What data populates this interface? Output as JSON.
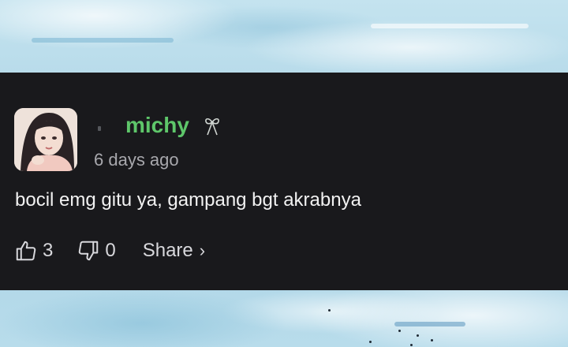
{
  "comment": {
    "username": "michy",
    "username_color": "#5ec66a",
    "username_badge_icon": "ribbon-bow-icon",
    "timestamp": "6 days ago",
    "text": "bocil emg gitu ya, gampang bgt akrabnya"
  },
  "actions": {
    "like_icon": "thumbs-up-icon",
    "like_count": "3",
    "dislike_icon": "thumbs-down-icon",
    "dislike_count": "0",
    "share_label": "Share",
    "share_chevron": "›"
  },
  "colors": {
    "card_background": "#19191c",
    "text_primary": "#f2f2f2",
    "text_secondary": "#a8a8ad"
  }
}
